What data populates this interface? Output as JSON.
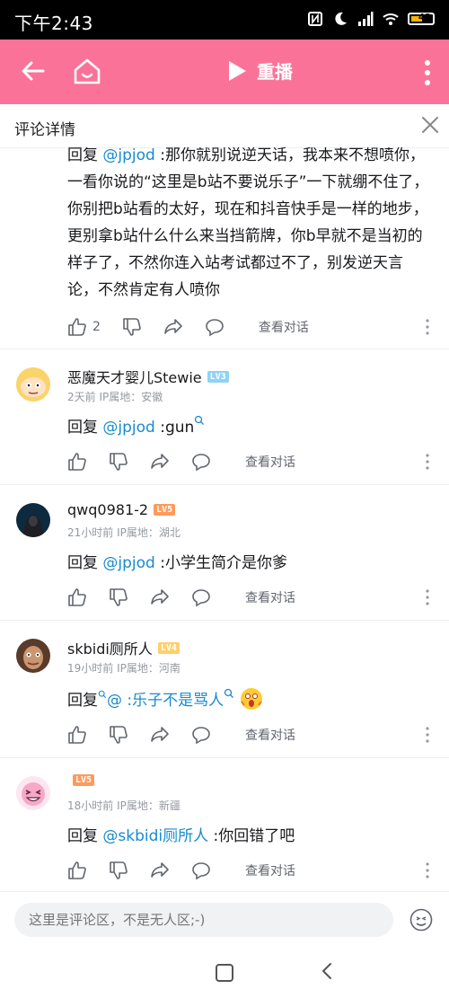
{
  "status_bar": {
    "time": "下午2:43",
    "battery": "42"
  },
  "app_bar": {
    "replay_label": "重播"
  },
  "sheet": {
    "title": "评论详情"
  },
  "comments": [
    {
      "reply_prefix": "回复 ",
      "mention": "@jpjod",
      "text": " :那你就别说逆天话，我本来不想喷你，一看你说的“这里是b站不要说乐子”一下就绷不住了，你别把b站看的太好，现在和抖音快手是一样的地步，更别拿b站什么什么来当挡箭牌，你b早就不是当初的样子了，不然你连入站考试都过不了，别发逆天言论，不然肯定有人喷你",
      "likes": "2",
      "dialog_label": "查看对话"
    },
    {
      "username": "恶魔天才婴儿Stewie",
      "level": "LV3",
      "level_color": "#8fd2f5",
      "time": "2天前",
      "ip": "IP属地：安徽",
      "reply_prefix": "回复 ",
      "mention": "@jpjod",
      "text": " :gun",
      "dialog_label": "查看对话"
    },
    {
      "username": "qwq0981-2",
      "level": "LV5",
      "level_color": "#ff9a5a",
      "time": "21小时前",
      "ip": "IP属地：湖北",
      "reply_prefix": "回复 ",
      "mention": "@jpjod",
      "text": " :小学生简介是你爹",
      "dialog_label": "查看对话"
    },
    {
      "username": "skbidi厕所人",
      "level": "LV4",
      "level_color": "#ffcf6b",
      "time": "19小时前",
      "ip": "IP属地：河南",
      "reply_prefix": "回复",
      "mention": "@",
      "text": " :乐子不是骂人",
      "dialog_label": "查看对话"
    },
    {
      "username": "",
      "level": "LV5",
      "level_color": "#ff9a5a",
      "time": "18小时前",
      "ip": "IP属地：新疆",
      "reply_prefix": "回复 ",
      "mention": "@skbidi厕所人",
      "text": " :你回错了吧",
      "dialog_label": "查看对话"
    }
  ],
  "composer": {
    "placeholder": "这里是评论区，不是无人区;-)"
  },
  "colors": {
    "brand_pink": "#fb7299",
    "mention_blue": "#178bcf",
    "meta_gray": "#9499a0"
  }
}
